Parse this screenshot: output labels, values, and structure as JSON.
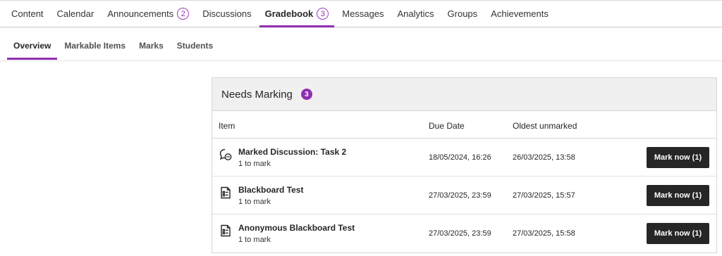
{
  "topnav": {
    "tabs": [
      {
        "label": "Content",
        "badge": ""
      },
      {
        "label": "Calendar",
        "badge": ""
      },
      {
        "label": "Announcements",
        "badge": "2"
      },
      {
        "label": "Discussions",
        "badge": ""
      },
      {
        "label": "Gradebook",
        "badge": "3",
        "active": true
      },
      {
        "label": "Messages",
        "badge": ""
      },
      {
        "label": "Analytics",
        "badge": ""
      },
      {
        "label": "Groups",
        "badge": ""
      },
      {
        "label": "Achievements",
        "badge": ""
      }
    ]
  },
  "subnav": {
    "tabs": [
      {
        "label": "Overview",
        "active": true
      },
      {
        "label": "Markable Items"
      },
      {
        "label": "Marks"
      },
      {
        "label": "Students"
      }
    ]
  },
  "panel": {
    "title": "Needs Marking",
    "count": "3",
    "columns": {
      "item": "Item",
      "due": "Due Date",
      "oldest": "Oldest unmarked"
    },
    "rows": [
      {
        "icon": "discussion-icon",
        "name": "Marked Discussion: Task 2",
        "sub": "1 to mark",
        "due": "18/05/2024, 16:26",
        "oldest": "26/03/2025, 13:58",
        "button": "Mark now (1)"
      },
      {
        "icon": "test-document-icon",
        "name": "Blackboard Test",
        "sub": "1 to mark",
        "due": "27/03/2025, 23:59",
        "oldest": "27/03/2025, 15:57",
        "button": "Mark now (1)"
      },
      {
        "icon": "test-document-icon",
        "name": "Anonymous Blackboard Test",
        "sub": "1 to mark",
        "due": "27/03/2025, 23:59",
        "oldest": "27/03/2025, 15:58",
        "button": "Mark now (1)"
      }
    ]
  },
  "colors": {
    "accent": "#8f2fb0",
    "button": "#262626",
    "header_bg": "#f0f0f0"
  }
}
